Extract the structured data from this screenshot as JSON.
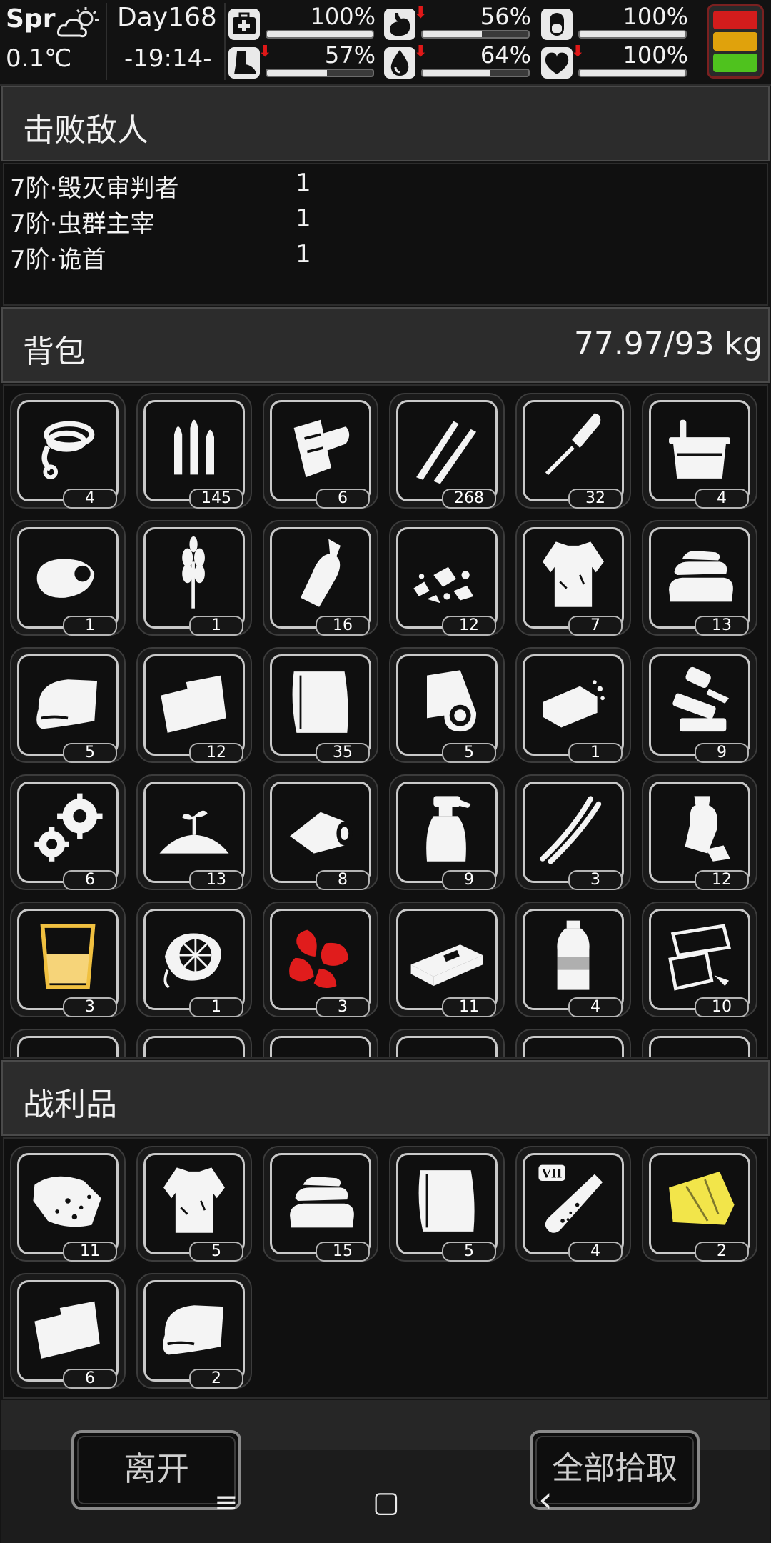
{
  "status": {
    "season": "Spr",
    "temperature": "0.1℃",
    "day": "Day168",
    "time": "-19:14-",
    "stats": [
      {
        "name": "health",
        "icon": "medkit-icon",
        "value": "100%",
        "fill": 1.0,
        "down": false
      },
      {
        "name": "hunger",
        "icon": "stomach-icon",
        "value": "56%",
        "fill": 0.56,
        "down": true
      },
      {
        "name": "mental",
        "icon": "capsule-icon",
        "value": "100%",
        "fill": 1.0,
        "down": false
      },
      {
        "name": "stamina",
        "icon": "foot-icon",
        "value": "57%",
        "fill": 0.57,
        "down": true
      },
      {
        "name": "thirst",
        "icon": "water-drop-icon",
        "value": "64%",
        "fill": 0.64,
        "down": true
      },
      {
        "name": "mood",
        "icon": "heart-icon",
        "value": "100%",
        "fill": 1.0,
        "down": true
      }
    ],
    "alert_colors": [
      "#d21c1c",
      "#e0a20c",
      "#4fc21e"
    ]
  },
  "defeated": {
    "title": "击败敌人",
    "enemies": [
      {
        "name": "7阶·毁灭审判者",
        "count": "1"
      },
      {
        "name": "7阶·虫群主宰",
        "count": "1"
      },
      {
        "name": "7阶·诡首",
        "count": "1"
      }
    ]
  },
  "backpack": {
    "title": "背包",
    "weight": "77.97/93 kg",
    "items": [
      {
        "icon": "rope-icon",
        "qty": "4"
      },
      {
        "icon": "bullets-icon",
        "qty": "145"
      },
      {
        "icon": "paper-scroll-icon",
        "qty": "6"
      },
      {
        "icon": "rifle-rounds-icon",
        "qty": "268"
      },
      {
        "icon": "rpg-rocket-icon",
        "qty": "32"
      },
      {
        "icon": "bucket-icon",
        "qty": "4"
      },
      {
        "icon": "bread-bun-icon",
        "qty": "1"
      },
      {
        "icon": "wheat-icon",
        "qty": "1"
      },
      {
        "icon": "bottle-icon",
        "qty": "16"
      },
      {
        "icon": "rubble-icon",
        "qty": "12"
      },
      {
        "icon": "torn-shirt-icon",
        "qty": "7"
      },
      {
        "icon": "folded-cloth-icon",
        "qty": "13"
      },
      {
        "icon": "towel-icon",
        "qty": "5"
      },
      {
        "icon": "paper-sheets-icon",
        "qty": "12"
      },
      {
        "icon": "blanket-icon",
        "qty": "35"
      },
      {
        "icon": "fabric-roll-icon",
        "qty": "5"
      },
      {
        "icon": "soap-bar-icon",
        "qty": "1"
      },
      {
        "icon": "scrap-parts-icon",
        "qty": "9"
      },
      {
        "icon": "gears-icon",
        "qty": "6"
      },
      {
        "icon": "sprout-soil-icon",
        "qty": "13"
      },
      {
        "icon": "bandage-roll-icon",
        "qty": "8"
      },
      {
        "icon": "spray-bottle-icon",
        "qty": "9"
      },
      {
        "icon": "wires-icon",
        "qty": "3"
      },
      {
        "icon": "plastic-trash-icon",
        "qty": "12"
      },
      {
        "icon": "juice-glass-icon",
        "qty": "3"
      },
      {
        "icon": "gas-mask-icon",
        "qty": "1"
      },
      {
        "icon": "red-herb-icon",
        "qty": "3"
      },
      {
        "icon": "cash-bundle-icon",
        "qty": "11"
      },
      {
        "icon": "water-bottle-icon",
        "qty": "4"
      },
      {
        "icon": "metal-sheets-icon",
        "qty": "10"
      },
      {
        "icon": "partial-item-icon",
        "qty": ""
      },
      {
        "icon": "partial-item-icon",
        "qty": ""
      },
      {
        "icon": "partial-item-icon",
        "qty": ""
      },
      {
        "icon": "partial-item-icon",
        "qty": ""
      },
      {
        "icon": "partial-item-icon",
        "qty": ""
      },
      {
        "icon": "partial-item-icon",
        "qty": ""
      }
    ]
  },
  "loot": {
    "title": "战利品",
    "items": [
      {
        "icon": "ore-chunk-icon",
        "qty": "11"
      },
      {
        "icon": "torn-shirt-icon",
        "qty": "5"
      },
      {
        "icon": "folded-cloth-icon",
        "qty": "15"
      },
      {
        "icon": "blanket-icon",
        "qty": "5"
      },
      {
        "icon": "test-tube-icon",
        "qty": "4",
        "label": "VII"
      },
      {
        "icon": "yellow-cloth-icon",
        "qty": "2"
      },
      {
        "icon": "paper-sheets-icon",
        "qty": "6"
      },
      {
        "icon": "towel-icon",
        "qty": "2"
      }
    ]
  },
  "actions": {
    "leave": "离开",
    "take_all": "全部拾取"
  },
  "navbar": {
    "menu": "≡",
    "home": "▢",
    "back": "‹"
  }
}
